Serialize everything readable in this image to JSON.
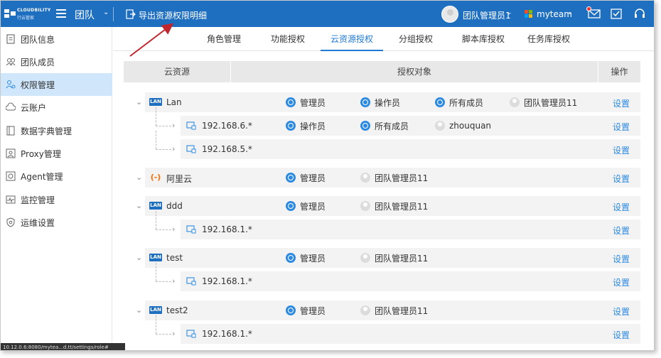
{
  "topbar": {
    "logo_text": "CLOUDBILITY",
    "logo_sub": "行云管家",
    "team_label": "团队",
    "export_label": "导出资源权限明细",
    "user_name": "团队管理员1",
    "org_name": "myteam",
    "colors": {
      "bar": "#1f6fc0",
      "notify": "#e33333"
    }
  },
  "sidebar": {
    "items": [
      {
        "label": "团队信息",
        "icon": "team-info-icon"
      },
      {
        "label": "团队成员",
        "icon": "members-icon"
      },
      {
        "label": "权限管理",
        "icon": "permission-icon",
        "active": true
      },
      {
        "label": "云账户",
        "icon": "cloud-icon"
      },
      {
        "label": "数据字典管理",
        "icon": "dictionary-icon"
      },
      {
        "label": "Proxy管理",
        "icon": "proxy-icon"
      },
      {
        "label": "Agent管理",
        "icon": "agent-icon"
      },
      {
        "label": "监控管理",
        "icon": "monitor-icon"
      },
      {
        "label": "运维设置",
        "icon": "ops-settings-icon"
      }
    ],
    "status_url": "10.12.0.6:8080/mytea...d.tt/settings/role#"
  },
  "tabs": [
    {
      "label": "角色管理"
    },
    {
      "label": "功能授权"
    },
    {
      "label": "云资源授权",
      "active": true
    },
    {
      "label": "分组授权"
    },
    {
      "label": "脚本库授权"
    },
    {
      "label": "任务库授权"
    }
  ],
  "table": {
    "headers": {
      "resource": "云资源",
      "target": "授权对象",
      "action": "操作"
    },
    "set_label": "设置",
    "rows": [
      {
        "level": 0,
        "type": "lan",
        "name": "Lan",
        "targets": [
          {
            "name": "管理员",
            "kind": "group"
          },
          {
            "name": "操作员",
            "kind": "group"
          },
          {
            "name": "所有成员",
            "kind": "group"
          },
          {
            "name": "团队管理员11",
            "kind": "user"
          }
        ]
      },
      {
        "level": 1,
        "name": "192.168.6.*",
        "targets": [
          {
            "name": "操作员",
            "kind": "group"
          },
          {
            "name": "所有成员",
            "kind": "group"
          },
          {
            "name": "zhouquan",
            "kind": "user"
          }
        ]
      },
      {
        "level": 1,
        "name": "192.168.5.*",
        "targets": []
      },
      {
        "level": 0,
        "type": "aliyun",
        "name": "阿里云",
        "targets": [
          {
            "name": "管理员",
            "kind": "group"
          },
          {
            "name": "团队管理员11",
            "kind": "user"
          }
        ]
      },
      {
        "level": 0,
        "type": "lan",
        "name": "ddd",
        "targets": [
          {
            "name": "管理员",
            "kind": "group"
          },
          {
            "name": "团队管理员11",
            "kind": "user"
          }
        ]
      },
      {
        "level": 1,
        "name": "192.168.1.*",
        "targets": []
      },
      {
        "level": 0,
        "type": "lan",
        "name": "test",
        "targets": [
          {
            "name": "管理员",
            "kind": "group"
          },
          {
            "name": "团队管理员11",
            "kind": "user"
          }
        ]
      },
      {
        "level": 1,
        "name": "192.168.1.*",
        "targets": []
      },
      {
        "level": 0,
        "type": "lan",
        "name": "test2",
        "targets": [
          {
            "name": "管理员",
            "kind": "group"
          },
          {
            "name": "团队管理员11",
            "kind": "user"
          }
        ]
      },
      {
        "level": 1,
        "name": "192.168.1.*",
        "targets": []
      }
    ]
  },
  "badges": {
    "lan": "LAN",
    "aliyun": "(-)"
  }
}
